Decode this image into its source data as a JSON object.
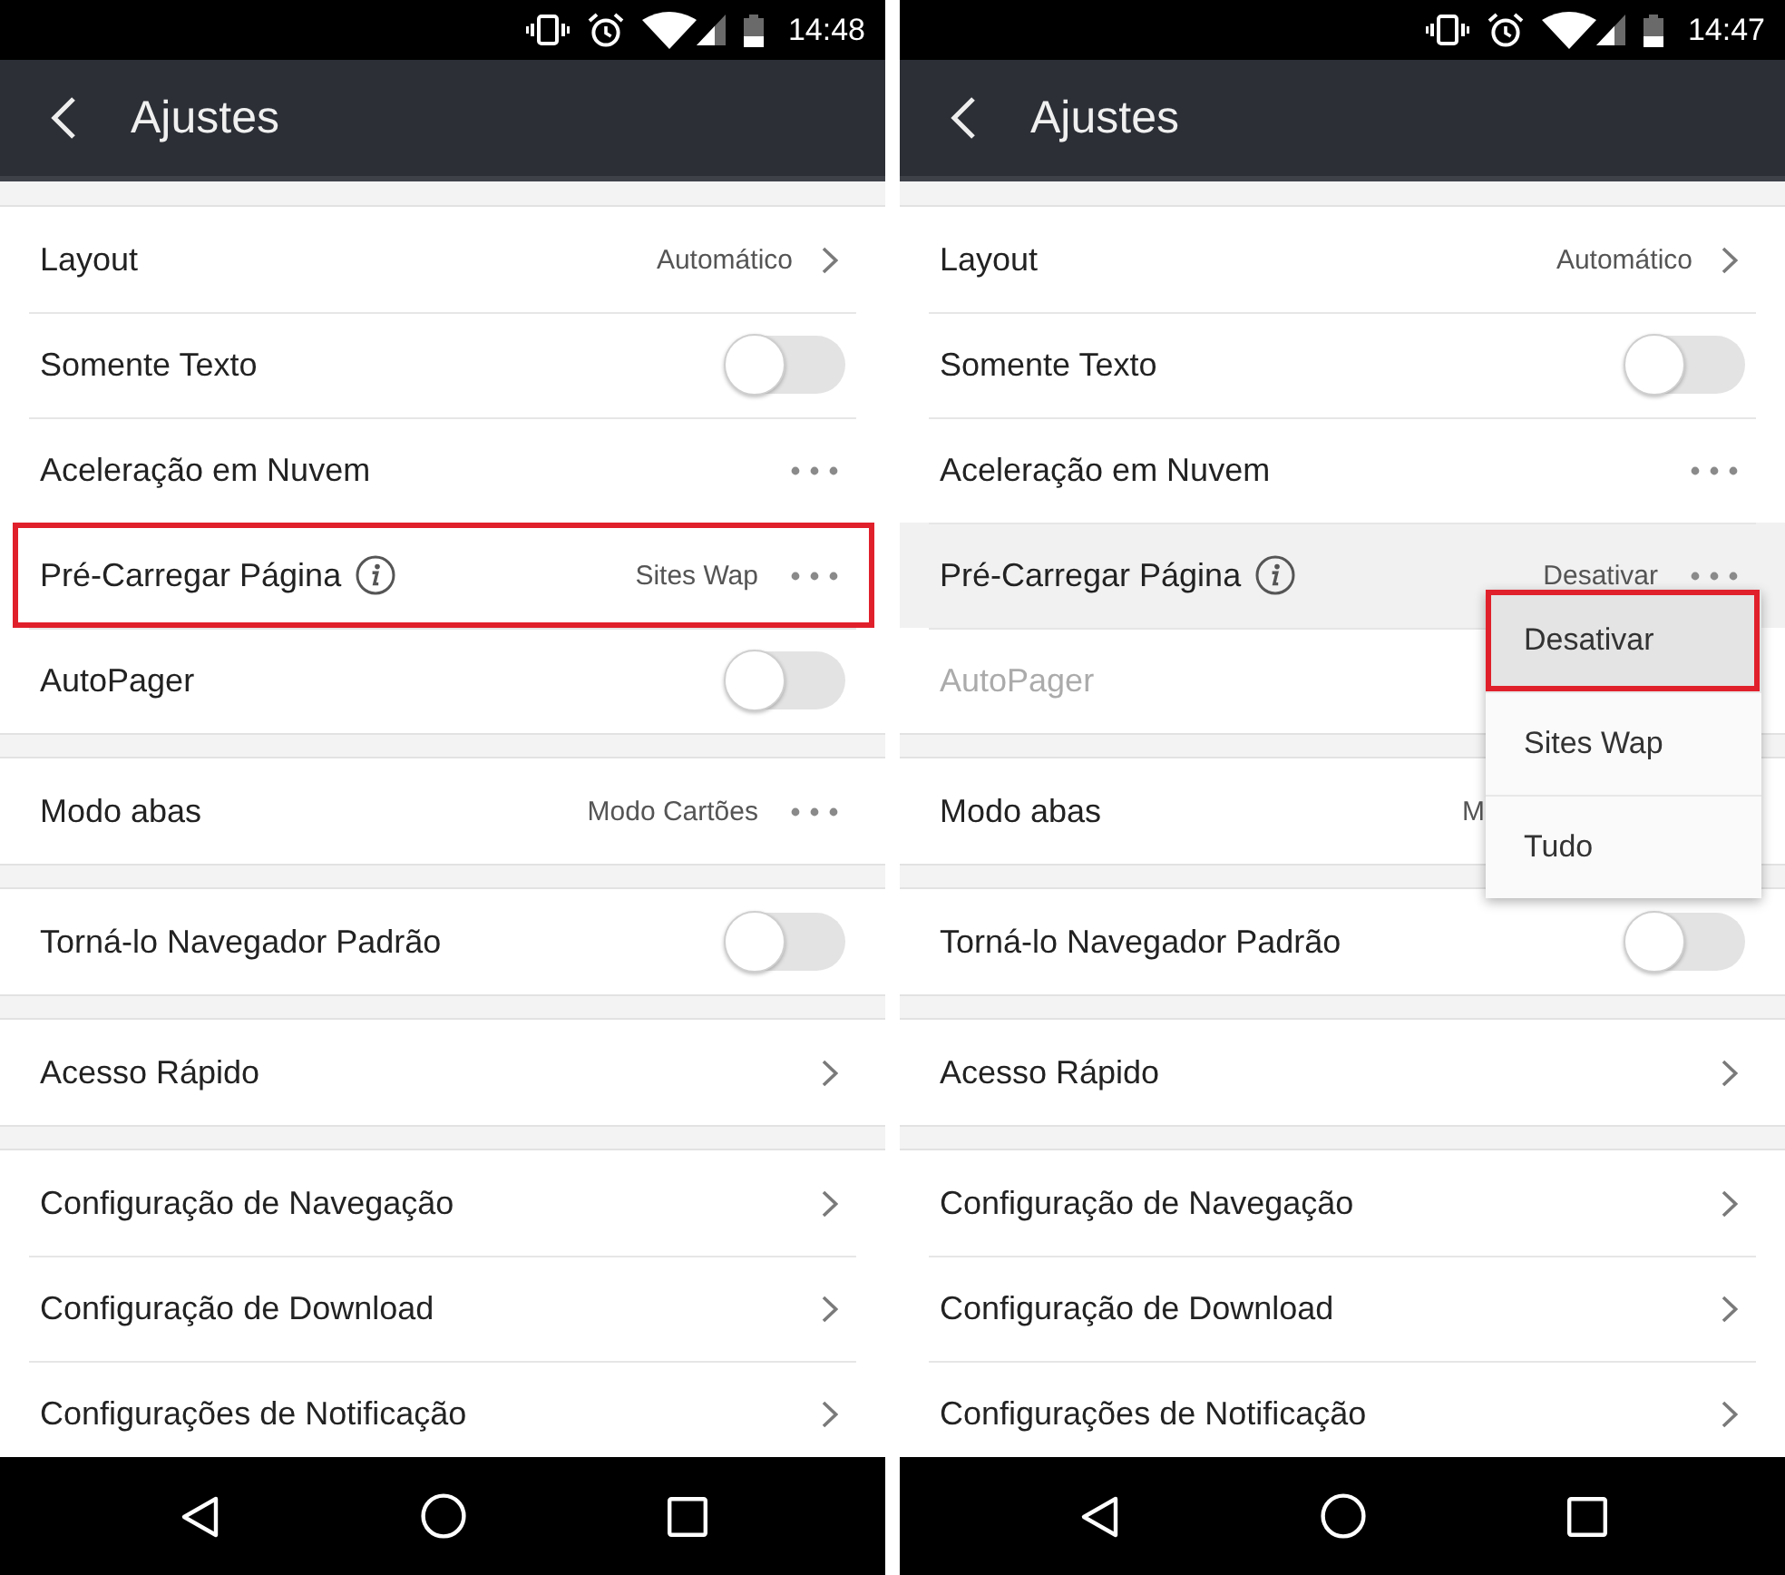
{
  "screens": [
    {
      "status_bar": {
        "time": "14:48"
      },
      "app_bar": {
        "title": "Ajustes"
      },
      "groups": [
        {
          "rows": [
            {
              "label": "Layout",
              "kind": "link",
              "value": "Automático",
              "disabled": false,
              "pressed": false,
              "annotated": false
            },
            {
              "label": "Somente Texto",
              "kind": "toggle",
              "on": false,
              "disabled": false,
              "pressed": false,
              "annotated": false
            },
            {
              "label": "Aceleração em Nuvem",
              "kind": "more",
              "disabled": false,
              "pressed": false,
              "annotated": false
            },
            {
              "label": "Pré-Carregar Página",
              "info": true,
              "kind": "more",
              "value": "Sites Wap",
              "disabled": false,
              "pressed": false,
              "annotated": true
            },
            {
              "label": "AutoPager",
              "kind": "toggle",
              "on": false,
              "disabled": false,
              "pressed": false,
              "annotated": false
            }
          ]
        },
        {
          "rows": [
            {
              "label": "Modo abas",
              "kind": "more",
              "value": "Modo Cartões",
              "disabled": false,
              "pressed": false,
              "annotated": false
            }
          ]
        },
        {
          "rows": [
            {
              "label": "Torná-lo Navegador Padrão",
              "kind": "toggle",
              "on": false,
              "disabled": false,
              "pressed": false,
              "annotated": false
            }
          ]
        },
        {
          "rows": [
            {
              "label": "Acesso Rápido",
              "kind": "link",
              "disabled": false,
              "pressed": false,
              "annotated": false
            }
          ]
        },
        {
          "rows": [
            {
              "label": "Configuração de Navegação",
              "kind": "link",
              "disabled": false,
              "pressed": false,
              "annotated": false
            },
            {
              "label": "Configuração de Download",
              "kind": "link",
              "disabled": false,
              "pressed": false,
              "annotated": false
            },
            {
              "label": "Configurações de Notificação",
              "kind": "link",
              "disabled": false,
              "pressed": false,
              "annotated": false
            }
          ]
        }
      ]
    },
    {
      "status_bar": {
        "time": "14:47"
      },
      "app_bar": {
        "title": "Ajustes"
      },
      "groups": [
        {
          "rows": [
            {
              "label": "Layout",
              "kind": "link",
              "value": "Automático",
              "disabled": false,
              "pressed": false,
              "annotated": false
            },
            {
              "label": "Somente Texto",
              "kind": "toggle",
              "on": false,
              "disabled": false,
              "pressed": false,
              "annotated": false
            },
            {
              "label": "Aceleração em Nuvem",
              "kind": "more",
              "disabled": false,
              "pressed": false,
              "annotated": false
            },
            {
              "label": "Pré-Carregar Página",
              "info": true,
              "kind": "more",
              "value": "Desativar",
              "disabled": false,
              "pressed": true,
              "annotated": false,
              "menu": {
                "items": [
                  {
                    "label": "Desativar",
                    "selected": true,
                    "annotated": true
                  },
                  {
                    "label": "Sites Wap",
                    "selected": false,
                    "annotated": false
                  },
                  {
                    "label": "Tudo",
                    "selected": false,
                    "annotated": false
                  }
                ]
              }
            },
            {
              "label": "AutoPager",
              "kind": "covered",
              "disabled": true,
              "pressed": false,
              "annotated": false
            }
          ]
        },
        {
          "rows": [
            {
              "label": "Modo abas",
              "kind": "covered",
              "value": "M",
              "disabled": false,
              "pressed": false,
              "annotated": false
            }
          ]
        },
        {
          "rows": [
            {
              "label": "Torná-lo Navegador Padrão",
              "kind": "toggle",
              "on": false,
              "disabled": false,
              "pressed": false,
              "annotated": false
            }
          ]
        },
        {
          "rows": [
            {
              "label": "Acesso Rápido",
              "kind": "link",
              "disabled": false,
              "pressed": false,
              "annotated": false
            }
          ]
        },
        {
          "rows": [
            {
              "label": "Configuração de Navegação",
              "kind": "link",
              "disabled": false,
              "pressed": false,
              "annotated": false
            },
            {
              "label": "Configuração de Download",
              "kind": "link",
              "disabled": false,
              "pressed": false,
              "annotated": false
            },
            {
              "label": "Configurações de Notificação",
              "kind": "link",
              "disabled": false,
              "pressed": false,
              "annotated": false
            }
          ]
        }
      ]
    }
  ]
}
